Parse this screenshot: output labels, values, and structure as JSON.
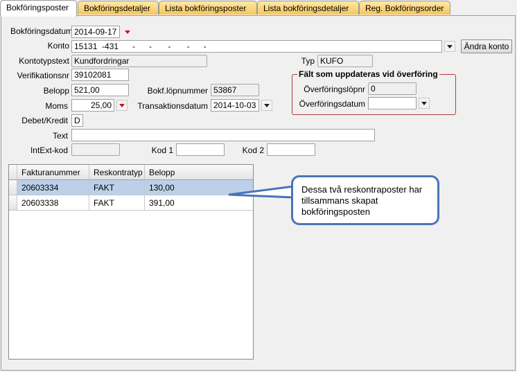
{
  "tabs": [
    "Bokföringsposter",
    "Bokföringsdetaljer",
    "Lista bokföringsposter",
    "Lista bokföringsdetaljer",
    "Reg. Bokföringsorder"
  ],
  "form": {
    "bokforingsdatum_label": "Bokföringsdatum",
    "bokforingsdatum_value": "2014-09-17",
    "konto_label": "Konto",
    "konto_value": "15131  -431      -      -       -       -      -",
    "andra_konto_label": "Ändra konto",
    "kontotypstext_label": "Kontotypstext",
    "kontotypstext_value": "Kundfordringar",
    "typ_label": "Typ",
    "typ_value": "KUFO",
    "verifikationsnr_label": "Verifikationsnr",
    "verifikationsnr_value": "39102081",
    "belopp_label": "Belopp",
    "belopp_value": "521,00",
    "bokf_lopnummer_label": "Bokf.löpnummer",
    "bokf_lopnummer_value": "53867",
    "moms_label": "Moms",
    "moms_value": "25,00",
    "transaktionsdatum_label": "Transaktionsdatum",
    "transaktionsdatum_value": "2014-10-03",
    "debet_kredit_label": "Debet/Kredit",
    "debet_kredit_value": "D",
    "text_label": "Text",
    "text_value": "",
    "intext_kod_label": "IntExt-kod",
    "intext_kod_value": "",
    "kod1_label": "Kod 1",
    "kod1_value": "",
    "kod2_label": "Kod 2",
    "kod2_value": ""
  },
  "transfer_group": {
    "title": "Fält som uppdateras vid överföring",
    "lopnr_label": "Överföringslöpnr",
    "lopnr_value": "0",
    "datum_label": "Överföringsdatum",
    "datum_value": ""
  },
  "grid": {
    "columns": [
      "Fakturanummer",
      "Reskontratyp",
      "Belopp"
    ],
    "rows": [
      {
        "fakturanummer": "20603334",
        "reskontratyp": "FAKT",
        "belopp": "130,00"
      },
      {
        "fakturanummer": "20603338",
        "reskontratyp": "FAKT",
        "belopp": "391,00"
      }
    ]
  },
  "callout": {
    "text": "Dessa två reskontraposter har tillsammans skapat bokföringsposten"
  },
  "colors": {
    "tab_gradient": "#f7c55a",
    "selected_row": "#bcd0ea",
    "callout_border": "#4a74b8",
    "group_border": "#b23a3a"
  },
  "icons": {
    "dropdown_red": "chevron-down-icon",
    "dropdown_black": "chevron-down-icon"
  }
}
